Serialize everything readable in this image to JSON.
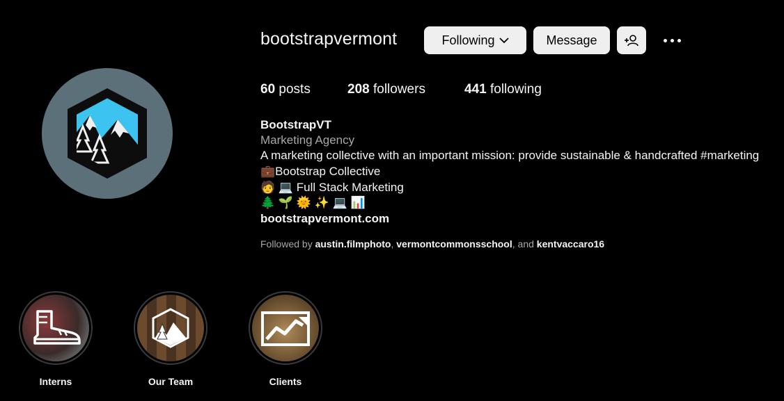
{
  "profile": {
    "username": "bootstrapvermont",
    "avatar_icon": "mountain-logo-icon",
    "buttons": {
      "following": "Following",
      "message": "Message"
    },
    "stats": {
      "posts_count": "60",
      "posts_label": "posts",
      "followers_count": "208",
      "followers_label": "followers",
      "following_count": "441",
      "following_label": "following"
    },
    "bio": {
      "name": "BootstrapVT",
      "category": "Marketing Agency",
      "text": "A marketing collective with an important mission: provide sustainable & handcrafted #marketing",
      "line2": "💼Bootstrap Collective",
      "line3": "🧑 💻 Full Stack Marketing",
      "line4": "🌲 🌱 🌞 ✨ 💻 📊",
      "link": "bootstrapvermont.com"
    },
    "followed_by": {
      "prefix": "Followed by",
      "user1": "austin.filmphoto",
      "sep1": ",",
      "user2": "vermontcommonsschool",
      "sep2": ", and",
      "user3": "kentvaccaro16"
    }
  },
  "highlights": [
    {
      "label": "Interns",
      "icon": "boot-icon"
    },
    {
      "label": "Our Team",
      "icon": "mountain-logo-icon"
    },
    {
      "label": "Clients",
      "icon": "chart-trend-icon"
    }
  ],
  "colors": {
    "background": "#000000",
    "text": "#f5f5f5",
    "muted": "#a8a8a8",
    "button_bg": "#efefef",
    "avatar_bg": "#5b7078",
    "logo_sky": "#3cc3f0"
  }
}
